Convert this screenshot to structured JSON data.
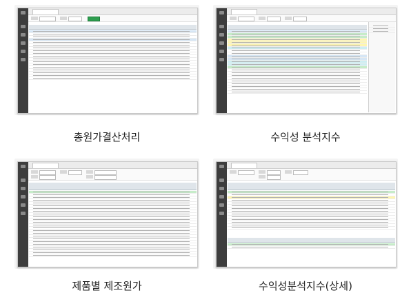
{
  "screenshots": [
    {
      "caption": "총원가결산처리"
    },
    {
      "caption": "수익성 분석지수"
    },
    {
      "caption": "제품별 제조원가"
    },
    {
      "caption": "수익성분석지수(상세)"
    }
  ],
  "colors": {
    "sidebar": "#3d3d3d",
    "header": "#dfe5ea",
    "row_blue": "#d6e6f5",
    "row_yellow": "#fff6b0",
    "row_green": "#c6ecc9",
    "row_cyan": "#cdeef2",
    "accent_green": "#2e9e4f"
  }
}
